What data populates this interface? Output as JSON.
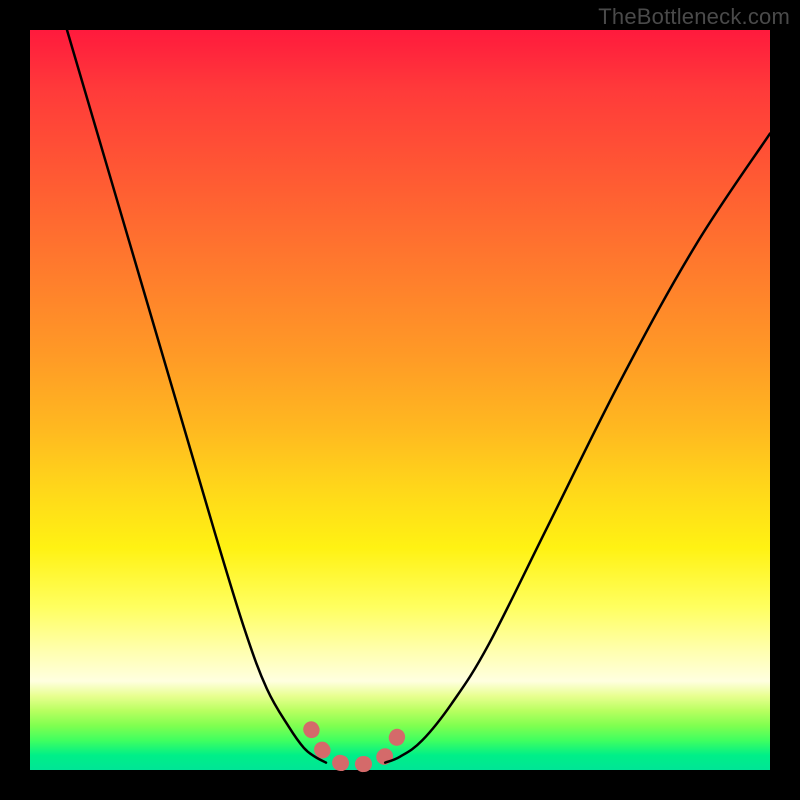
{
  "watermark": "TheBottleneck.com",
  "chart_data": {
    "type": "line",
    "title": "",
    "xlabel": "",
    "ylabel": "",
    "xlim": [
      0,
      1
    ],
    "ylim": [
      0,
      1
    ],
    "note": "No axes, ticks, or numeric labels are shown in the image; data points below are normalized (0–1) estimates read visually from the plot area, where y increases upward.",
    "series": [
      {
        "name": "left-branch",
        "x": [
          0.05,
          0.1,
          0.15,
          0.2,
          0.25,
          0.29,
          0.32,
          0.35,
          0.37,
          0.385,
          0.4
        ],
        "y": [
          1.0,
          0.83,
          0.66,
          0.49,
          0.32,
          0.19,
          0.11,
          0.058,
          0.03,
          0.018,
          0.01
        ]
      },
      {
        "name": "right-branch",
        "x": [
          0.48,
          0.5,
          0.53,
          0.57,
          0.62,
          0.7,
          0.8,
          0.9,
          1.0
        ],
        "y": [
          0.01,
          0.018,
          0.04,
          0.09,
          0.17,
          0.33,
          0.53,
          0.71,
          0.86
        ]
      },
      {
        "name": "bottom-highlight",
        "x": [
          0.38,
          0.395,
          0.41,
          0.43,
          0.45,
          0.47,
          0.488,
          0.5
        ],
        "y": [
          0.055,
          0.027,
          0.013,
          0.008,
          0.008,
          0.012,
          0.028,
          0.055
        ]
      }
    ],
    "styles": {
      "left-branch": {
        "stroke": "#000000",
        "width": 2.5
      },
      "right-branch": {
        "stroke": "#000000",
        "width": 2.5
      },
      "bottom-highlight": {
        "stroke": "#d46a6a",
        "width": 16,
        "linecap": "round",
        "dash": "1 22"
      }
    }
  }
}
